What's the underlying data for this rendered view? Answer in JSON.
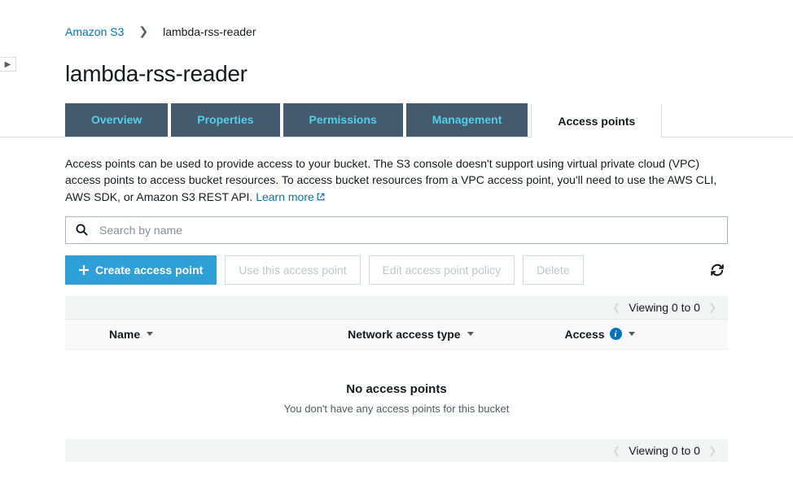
{
  "breadcrumb": {
    "root": "Amazon S3",
    "current": "lambda-rss-reader"
  },
  "page": {
    "title": "lambda-rss-reader"
  },
  "tabs": {
    "items": [
      {
        "label": "Overview"
      },
      {
        "label": "Properties"
      },
      {
        "label": "Permissions"
      },
      {
        "label": "Management"
      },
      {
        "label": "Access points"
      }
    ]
  },
  "description": {
    "text": "Access points can be used to provide access to your bucket. The S3 console doesn't support using virtual private cloud (VPC) access points to access bucket resources. To access bucket resources from a VPC access point, you'll need to use the AWS CLI, AWS SDK, or Amazon S3 REST API. ",
    "learn_more": "Learn more"
  },
  "search": {
    "placeholder": "Search by name"
  },
  "toolbar": {
    "create_label": "Create access point",
    "use_label": "Use this access point",
    "edit_label": "Edit access point policy",
    "delete_label": "Delete"
  },
  "pager": {
    "text": "Viewing 0 to 0"
  },
  "table": {
    "col_name": "Name",
    "col_network": "Network access type",
    "col_access": "Access"
  },
  "empty": {
    "headline": "No access points",
    "sub": "You don't have any access points for this bucket"
  }
}
